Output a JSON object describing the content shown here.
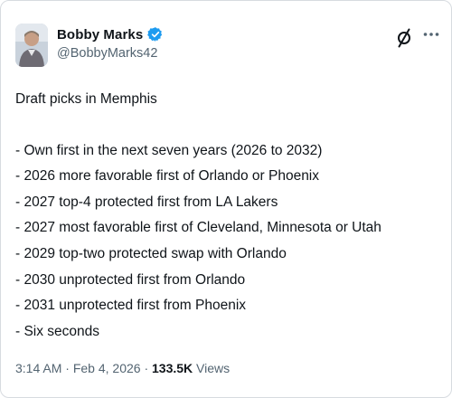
{
  "author": {
    "display_name": "Bobby Marks",
    "handle": "@BobbyMarks42",
    "verified": true,
    "avatar_icon": "profile-photo"
  },
  "icons": {
    "verified": "verified-badge-icon",
    "grok": "grok-icon",
    "more": "more-options-icon"
  },
  "colors": {
    "verified_blue": "#1d9bf0",
    "secondary_text": "#536471",
    "primary_text": "#0f1419"
  },
  "tweet": {
    "intro": "Draft picks in Memphis",
    "lines": [
      "- Own first in the next seven years (2026 to 2032)",
      "- 2026 more favorable first of Orlando or Phoenix",
      "- 2027 top-4 protected first from LA Lakers",
      "- 2027 most favorable first of Cleveland, Minnesota or Utah",
      "- 2029 top-two protected swap with Orlando",
      "- 2030 unprotected first from Orlando",
      "- 2031 unprotected first from Phoenix",
      "- Six seconds"
    ]
  },
  "meta": {
    "time": "3:14 AM",
    "separator": " · ",
    "date": "Feb 4, 2026",
    "views_count": "133.5K",
    "views_label": " Views"
  }
}
